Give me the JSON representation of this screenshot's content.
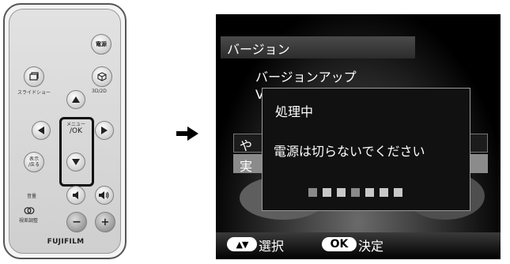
{
  "remote": {
    "power_label": "電源",
    "slideshow_label": "スライドショー",
    "mode_label": "3D/2D",
    "menu_ok_top": "メニュー",
    "menu_ok_bottom": "/OK",
    "display_back_top": "表示",
    "display_back_bottom": "/戻る",
    "volume_label": "音量",
    "parallax_label": "視差調整",
    "minus_label": "−",
    "plus_label": "+",
    "brand": "FUJIFILM"
  },
  "screen": {
    "title": "バージョン",
    "menu_item_1": "バージョンアップ",
    "menu_item_2_partial": "V",
    "menu_item_3_partial": "や",
    "menu_item_4_partial": "実",
    "dialog": {
      "title": "処理中",
      "message": "電源は切らないでください",
      "progress_total_blocks": 7
    },
    "hints": {
      "select_pill": "▲▼",
      "select_label": "選択",
      "ok_pill": "OK",
      "ok_label": "決定"
    }
  },
  "colors": {
    "screen_bg": "#000000",
    "dialog_border": "#9a9a9a",
    "pill_bg": "#ffffff",
    "highlight_frame": "#111111"
  }
}
